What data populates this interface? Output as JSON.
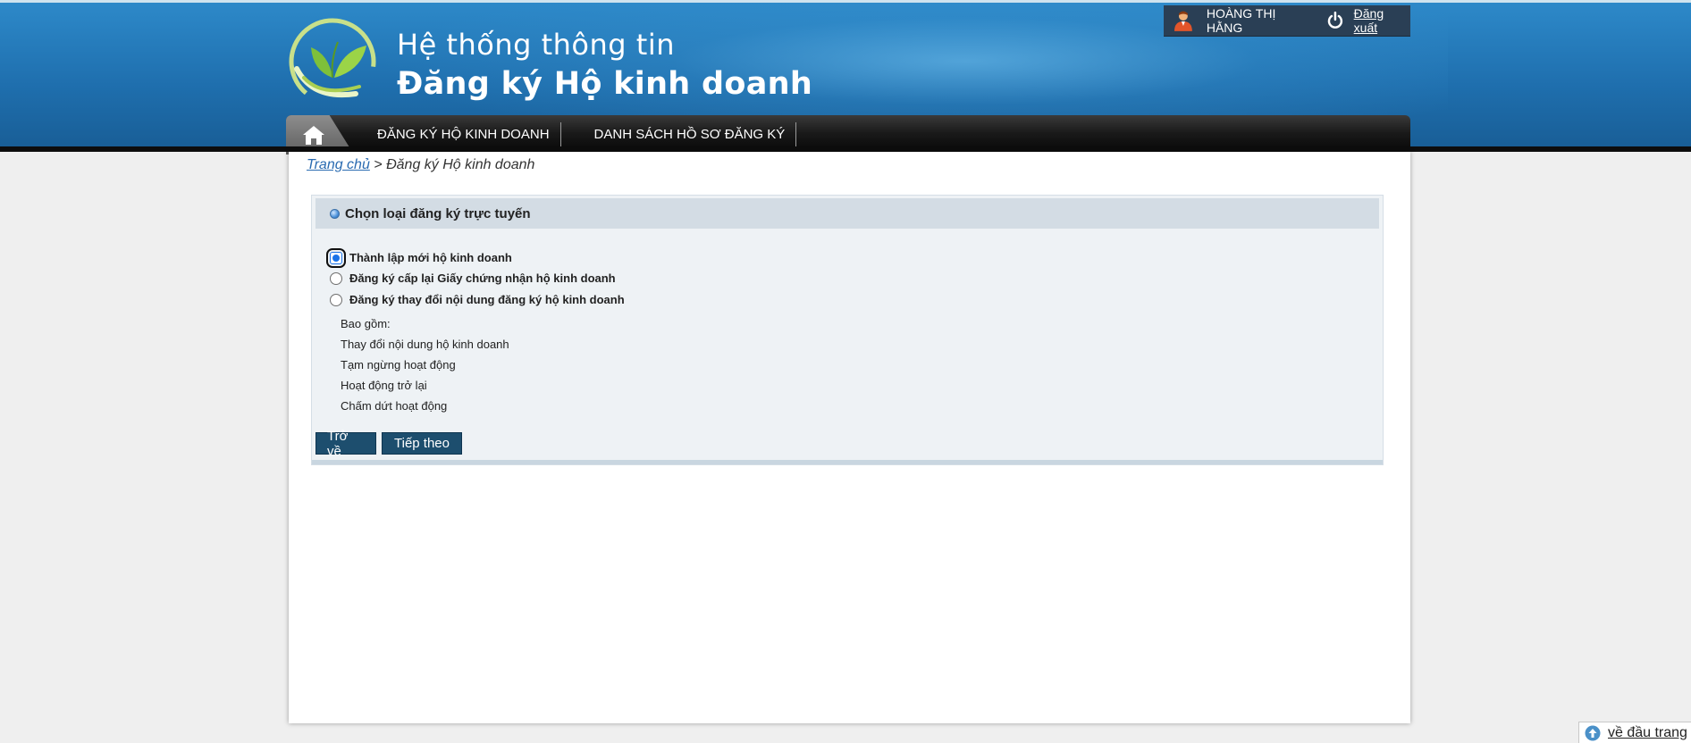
{
  "header": {
    "title_line1": "Hệ thống thông tin",
    "title_line2": "Đăng ký Hộ kinh doanh"
  },
  "user": {
    "name": "HOÀNG THỊ HẰNG",
    "logout_label": "Đăng xuất"
  },
  "nav": {
    "items": [
      {
        "label": "ĐĂNG KÝ HỘ KINH DOANH"
      },
      {
        "label": "DANH SÁCH HỒ SƠ ĐĂNG KÝ"
      }
    ]
  },
  "breadcrumb": {
    "home_label": "Trang chủ",
    "separator": " > ",
    "current": "Đăng ký Hộ kinh doanh"
  },
  "form": {
    "heading": "Chọn loại đăng ký trực tuyến",
    "options": [
      {
        "label": "Thành lập mới hộ kinh doanh",
        "checked": true
      },
      {
        "label": "Đăng ký cấp lại Giấy chứng nhận hộ kinh doanh",
        "checked": false
      },
      {
        "label": "Đăng ký thay đổi nội dung đăng ký hộ kinh doanh",
        "checked": false
      }
    ],
    "sub_items": [
      "Bao gồm:",
      "Thay đổi nội dung hộ kinh doanh",
      "Tạm ngừng hoạt động",
      "Hoạt động trở lại",
      "Chấm dứt hoạt động"
    ],
    "back_label": "Trở về",
    "next_label": "Tiếp theo"
  },
  "back_to_top_label": "về đầu trang",
  "colors": {
    "header_blue": "#1f6fae",
    "nav_black": "#050505",
    "button_blue": "#1d4e6e",
    "link_blue": "#2a6bb1"
  }
}
